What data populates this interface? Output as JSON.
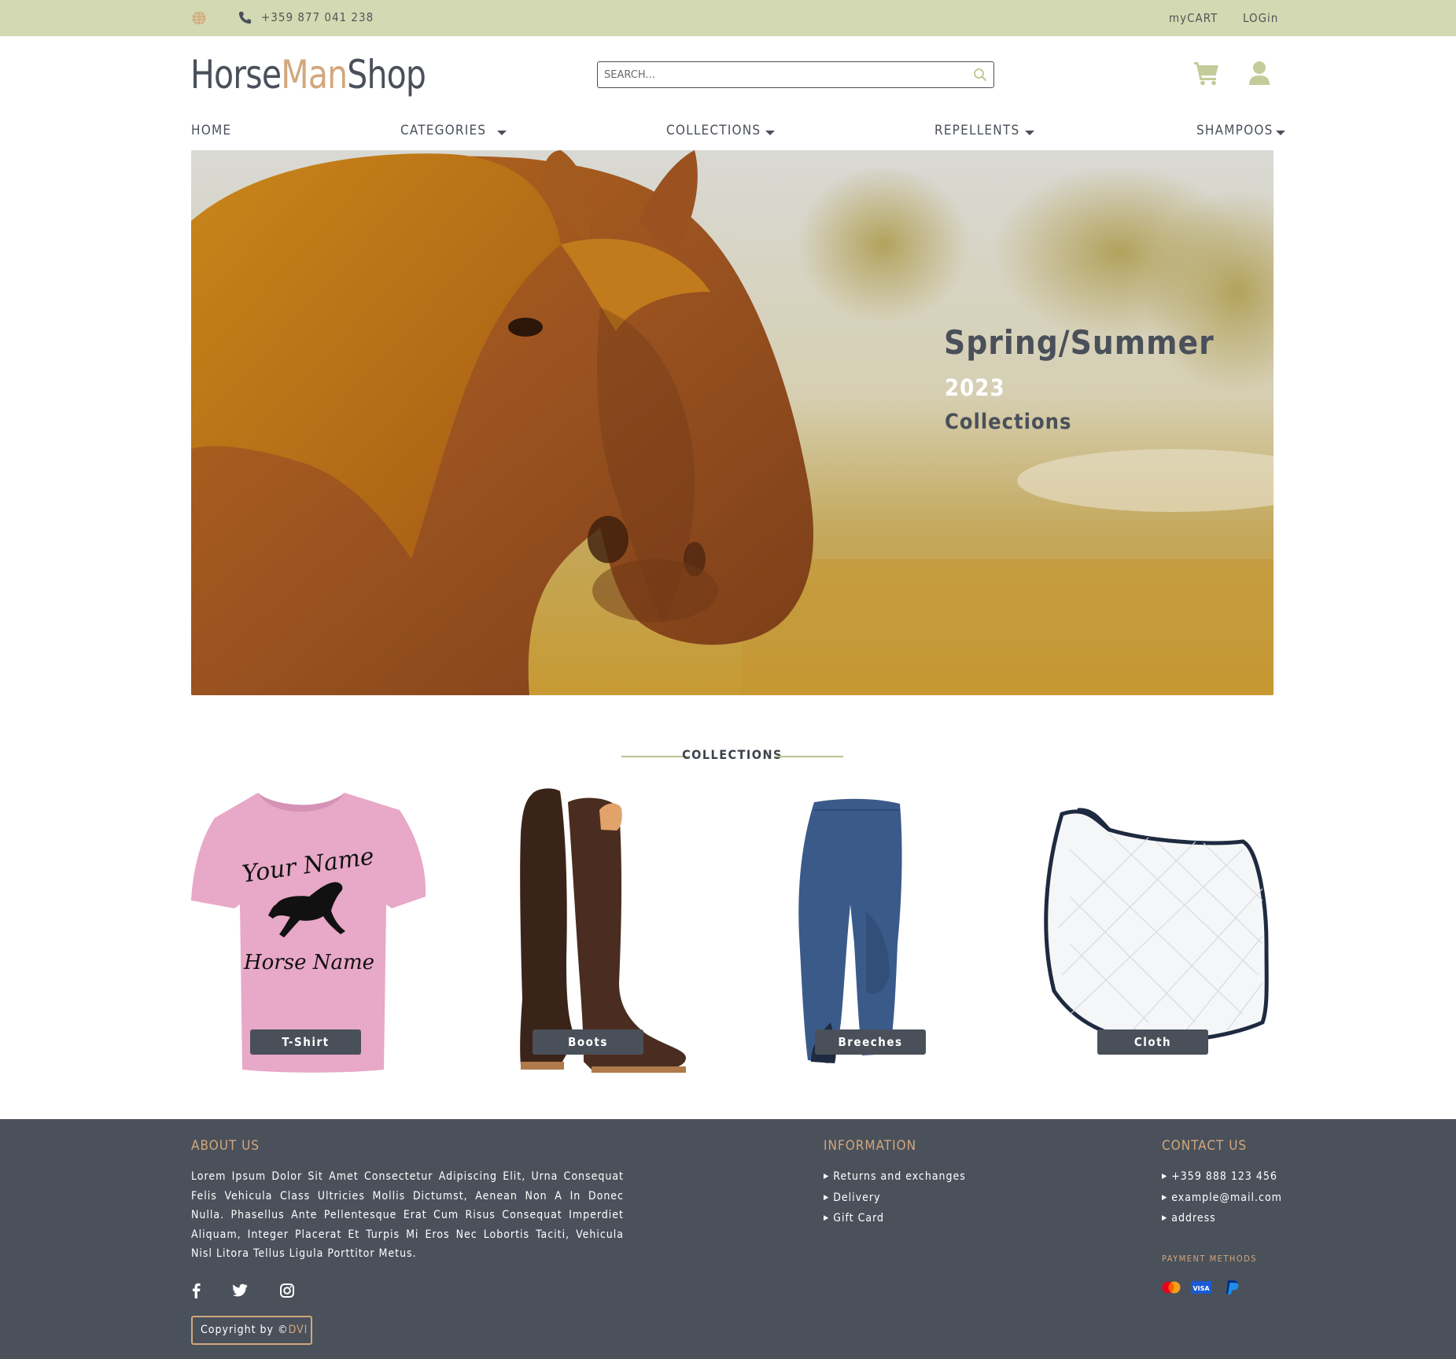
{
  "topbar": {
    "phone": "+359 877 041 238",
    "my_cart": "myCART",
    "login": "LOGin"
  },
  "header": {
    "logo_part1": "Horse",
    "logo_part2": "Man",
    "logo_part3": "Shop",
    "search_placeholder": "SEARCH..."
  },
  "nav": {
    "items": [
      {
        "label": "HOME",
        "dropdown": false
      },
      {
        "label": "CATEGORIES",
        "dropdown": true
      },
      {
        "label": "COLLECTIONS",
        "dropdown": true
      },
      {
        "label": "REPELLENTS",
        "dropdown": true
      },
      {
        "label": "SHAMPOOS",
        "dropdown": true
      }
    ]
  },
  "hero": {
    "line1": "Spring/Summer",
    "line2": "2023",
    "line3": "Collections"
  },
  "collections": {
    "title": "COLLECTIONS",
    "products": [
      {
        "label": "T-Shirt",
        "print_top": "Your Name",
        "print_bottom": "Horse Name"
      },
      {
        "label": "Boots"
      },
      {
        "label": "Breeches"
      },
      {
        "label": "Cloth"
      }
    ]
  },
  "footer": {
    "about_title": "ABOUT US",
    "about_text": "Lorem Ipsum Dolor Sit Amet Consectetur Adipiscing Elit, Urna Consequat Felis Vehicula Class Ultricies Mollis Dictumst, Aenean Non A In Donec Nulla. Phasellus Ante Pellentesque Erat Cum Risus Consequat Imperdiet Aliquam, Integer Placerat Et Turpis Mi Eros Nec Lobortis Taciti, Vehicula Nisl Litora Tellus Ligula Porttitor Metus.",
    "info_title": "INFORMATION",
    "info_links": [
      "Returns and exchanges",
      "Delivery",
      "Gift Card"
    ],
    "contact_title": "CONTACT US",
    "contact_items": [
      "+359 888 123 456",
      "example@mail.com",
      "address"
    ],
    "payment_title": "PAYMENT METHODS",
    "payment_icons": [
      "mastercard-icon",
      "visa-icon",
      "paypal-icon"
    ],
    "social_icons": [
      "facebook-icon",
      "twitter-icon",
      "instagram-icon"
    ],
    "copyright_prefix": "Copyright by ©",
    "copyright_brand": "DVI"
  },
  "colors": {
    "topbar_bg": "#d3dab3",
    "accent": "#d3a77c",
    "dark": "#4a505a",
    "footer_bg": "#4a515b"
  }
}
